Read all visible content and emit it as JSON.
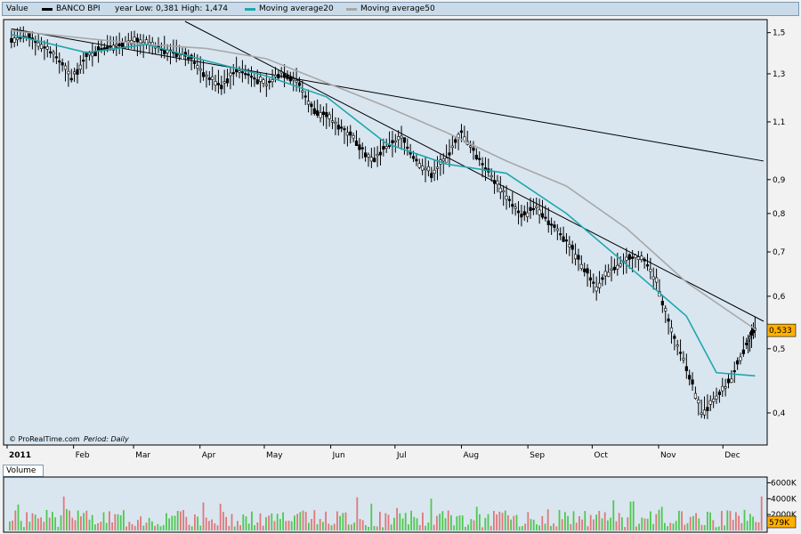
{
  "header": {
    "value_label": "Value",
    "instrument": "BANCO BPI",
    "year_range": "year Low: 0,381 High: 1,474",
    "ma20_label": "Moving average20",
    "ma50_label": "Moving average50"
  },
  "footer_note": "© ProRealTime.com",
  "period_text": "Period: Daily",
  "colors": {
    "panel_bg": "#d9e6f0",
    "ma20": "#1fa7ad",
    "ma50": "#a8a8a8",
    "price": "#000000",
    "vol_up": "#4fc84f",
    "vol_down": "#e07878",
    "last_price_bg": "#ffb000"
  },
  "chart_data": [
    {
      "type": "candlestick",
      "title": "BANCO BPI",
      "x_axis_labels": [
        "2011",
        "Feb",
        "Mar",
        "Apr",
        "May",
        "Jun",
        "Jul",
        "Aug",
        "Sep",
        "Oct",
        "Nov",
        "Dec"
      ],
      "y_scale": "log",
      "y_ticks": [
        "1,5",
        "1,3",
        "1,1",
        "0,9",
        "0,8",
        "0,7",
        "0,6",
        "0,5",
        "0,4"
      ],
      "ylim": [
        0.36,
        1.56
      ],
      "last_price": "0,533",
      "price_series": [
        {
          "x": "2011-01-03",
          "y": 1.47
        },
        {
          "x": "2011-01-10",
          "y": 1.48
        },
        {
          "x": "2011-01-17",
          "y": 1.44
        },
        {
          "x": "2011-01-24",
          "y": 1.38
        },
        {
          "x": "2011-01-31",
          "y": 1.28
        },
        {
          "x": "2011-02-07",
          "y": 1.38
        },
        {
          "x": "2011-02-14",
          "y": 1.42
        },
        {
          "x": "2011-02-21",
          "y": 1.44
        },
        {
          "x": "2011-02-28",
          "y": 1.46
        },
        {
          "x": "2011-03-07",
          "y": 1.44
        },
        {
          "x": "2011-03-14",
          "y": 1.42
        },
        {
          "x": "2011-03-21",
          "y": 1.4
        },
        {
          "x": "2011-03-28",
          "y": 1.37
        },
        {
          "x": "2011-04-04",
          "y": 1.29
        },
        {
          "x": "2011-04-11",
          "y": 1.25
        },
        {
          "x": "2011-04-18",
          "y": 1.32
        },
        {
          "x": "2011-04-25",
          "y": 1.29
        },
        {
          "x": "2011-05-02",
          "y": 1.25
        },
        {
          "x": "2011-05-09",
          "y": 1.31
        },
        {
          "x": "2011-05-16",
          "y": 1.27
        },
        {
          "x": "2011-05-23",
          "y": 1.16
        },
        {
          "x": "2011-05-30",
          "y": 1.12
        },
        {
          "x": "2011-06-06",
          "y": 1.08
        },
        {
          "x": "2011-06-13",
          "y": 1.03
        },
        {
          "x": "2011-06-20",
          "y": 0.96
        },
        {
          "x": "2011-06-27",
          "y": 1.01
        },
        {
          "x": "2011-07-04",
          "y": 1.04
        },
        {
          "x": "2011-07-11",
          "y": 0.96
        },
        {
          "x": "2011-07-18",
          "y": 0.92
        },
        {
          "x": "2011-07-25",
          "y": 0.97
        },
        {
          "x": "2011-08-01",
          "y": 1.06
        },
        {
          "x": "2011-08-08",
          "y": 0.98
        },
        {
          "x": "2011-08-15",
          "y": 0.91
        },
        {
          "x": "2011-08-22",
          "y": 0.85
        },
        {
          "x": "2011-08-29",
          "y": 0.79
        },
        {
          "x": "2011-09-05",
          "y": 0.82
        },
        {
          "x": "2011-09-12",
          "y": 0.77
        },
        {
          "x": "2011-09-19",
          "y": 0.73
        },
        {
          "x": "2011-09-26",
          "y": 0.67
        },
        {
          "x": "2011-10-03",
          "y": 0.62
        },
        {
          "x": "2011-10-10",
          "y": 0.66
        },
        {
          "x": "2011-10-17",
          "y": 0.68
        },
        {
          "x": "2011-10-24",
          "y": 0.69
        },
        {
          "x": "2011-10-31",
          "y": 0.63
        },
        {
          "x": "2011-11-07",
          "y": 0.53
        },
        {
          "x": "2011-11-14",
          "y": 0.47
        },
        {
          "x": "2011-11-21",
          "y": 0.4
        },
        {
          "x": "2011-11-28",
          "y": 0.42
        },
        {
          "x": "2011-12-05",
          "y": 0.45
        },
        {
          "x": "2011-12-12",
          "y": 0.51
        },
        {
          "x": "2011-12-16",
          "y": 0.533
        }
      ],
      "ma20": [
        {
          "x": "2011-01-03",
          "y": 1.49
        },
        {
          "x": "2011-02-07",
          "y": 1.4
        },
        {
          "x": "2011-03-07",
          "y": 1.44
        },
        {
          "x": "2011-04-04",
          "y": 1.36
        },
        {
          "x": "2011-05-02",
          "y": 1.29
        },
        {
          "x": "2011-05-30",
          "y": 1.2
        },
        {
          "x": "2011-06-27",
          "y": 1.02
        },
        {
          "x": "2011-07-25",
          "y": 0.95
        },
        {
          "x": "2011-08-22",
          "y": 0.92
        },
        {
          "x": "2011-09-19",
          "y": 0.8
        },
        {
          "x": "2011-10-17",
          "y": 0.67
        },
        {
          "x": "2011-11-14",
          "y": 0.56
        },
        {
          "x": "2011-11-28",
          "y": 0.46
        },
        {
          "x": "2011-12-16",
          "y": 0.455
        }
      ],
      "ma50": [
        {
          "x": "2011-01-03",
          "y": 1.51
        },
        {
          "x": "2011-02-07",
          "y": 1.47
        },
        {
          "x": "2011-03-07",
          "y": 1.44
        },
        {
          "x": "2011-04-04",
          "y": 1.42
        },
        {
          "x": "2011-05-02",
          "y": 1.37
        },
        {
          "x": "2011-05-30",
          "y": 1.26
        },
        {
          "x": "2011-06-27",
          "y": 1.16
        },
        {
          "x": "2011-07-25",
          "y": 1.06
        },
        {
          "x": "2011-08-22",
          "y": 0.96
        },
        {
          "x": "2011-09-19",
          "y": 0.88
        },
        {
          "x": "2011-10-17",
          "y": 0.76
        },
        {
          "x": "2011-11-14",
          "y": 0.63
        },
        {
          "x": "2011-12-16",
          "y": 0.535
        }
      ],
      "trendlines": [
        {
          "from": {
            "x": "2011-01-03",
            "y": 1.52
          },
          "to": {
            "x": "2011-12-20",
            "y": 0.96
          }
        },
        {
          "from": {
            "x": "2011-03-25",
            "y": 1.56
          },
          "to": {
            "x": "2011-12-20",
            "y": 0.55
          }
        }
      ]
    },
    {
      "type": "bar",
      "title": "Volume",
      "y_ticks": [
        "6000K",
        "4000K",
        "2000K"
      ],
      "last_value": "579K",
      "ylim": [
        0,
        6500
      ],
      "unit": "K"
    }
  ]
}
